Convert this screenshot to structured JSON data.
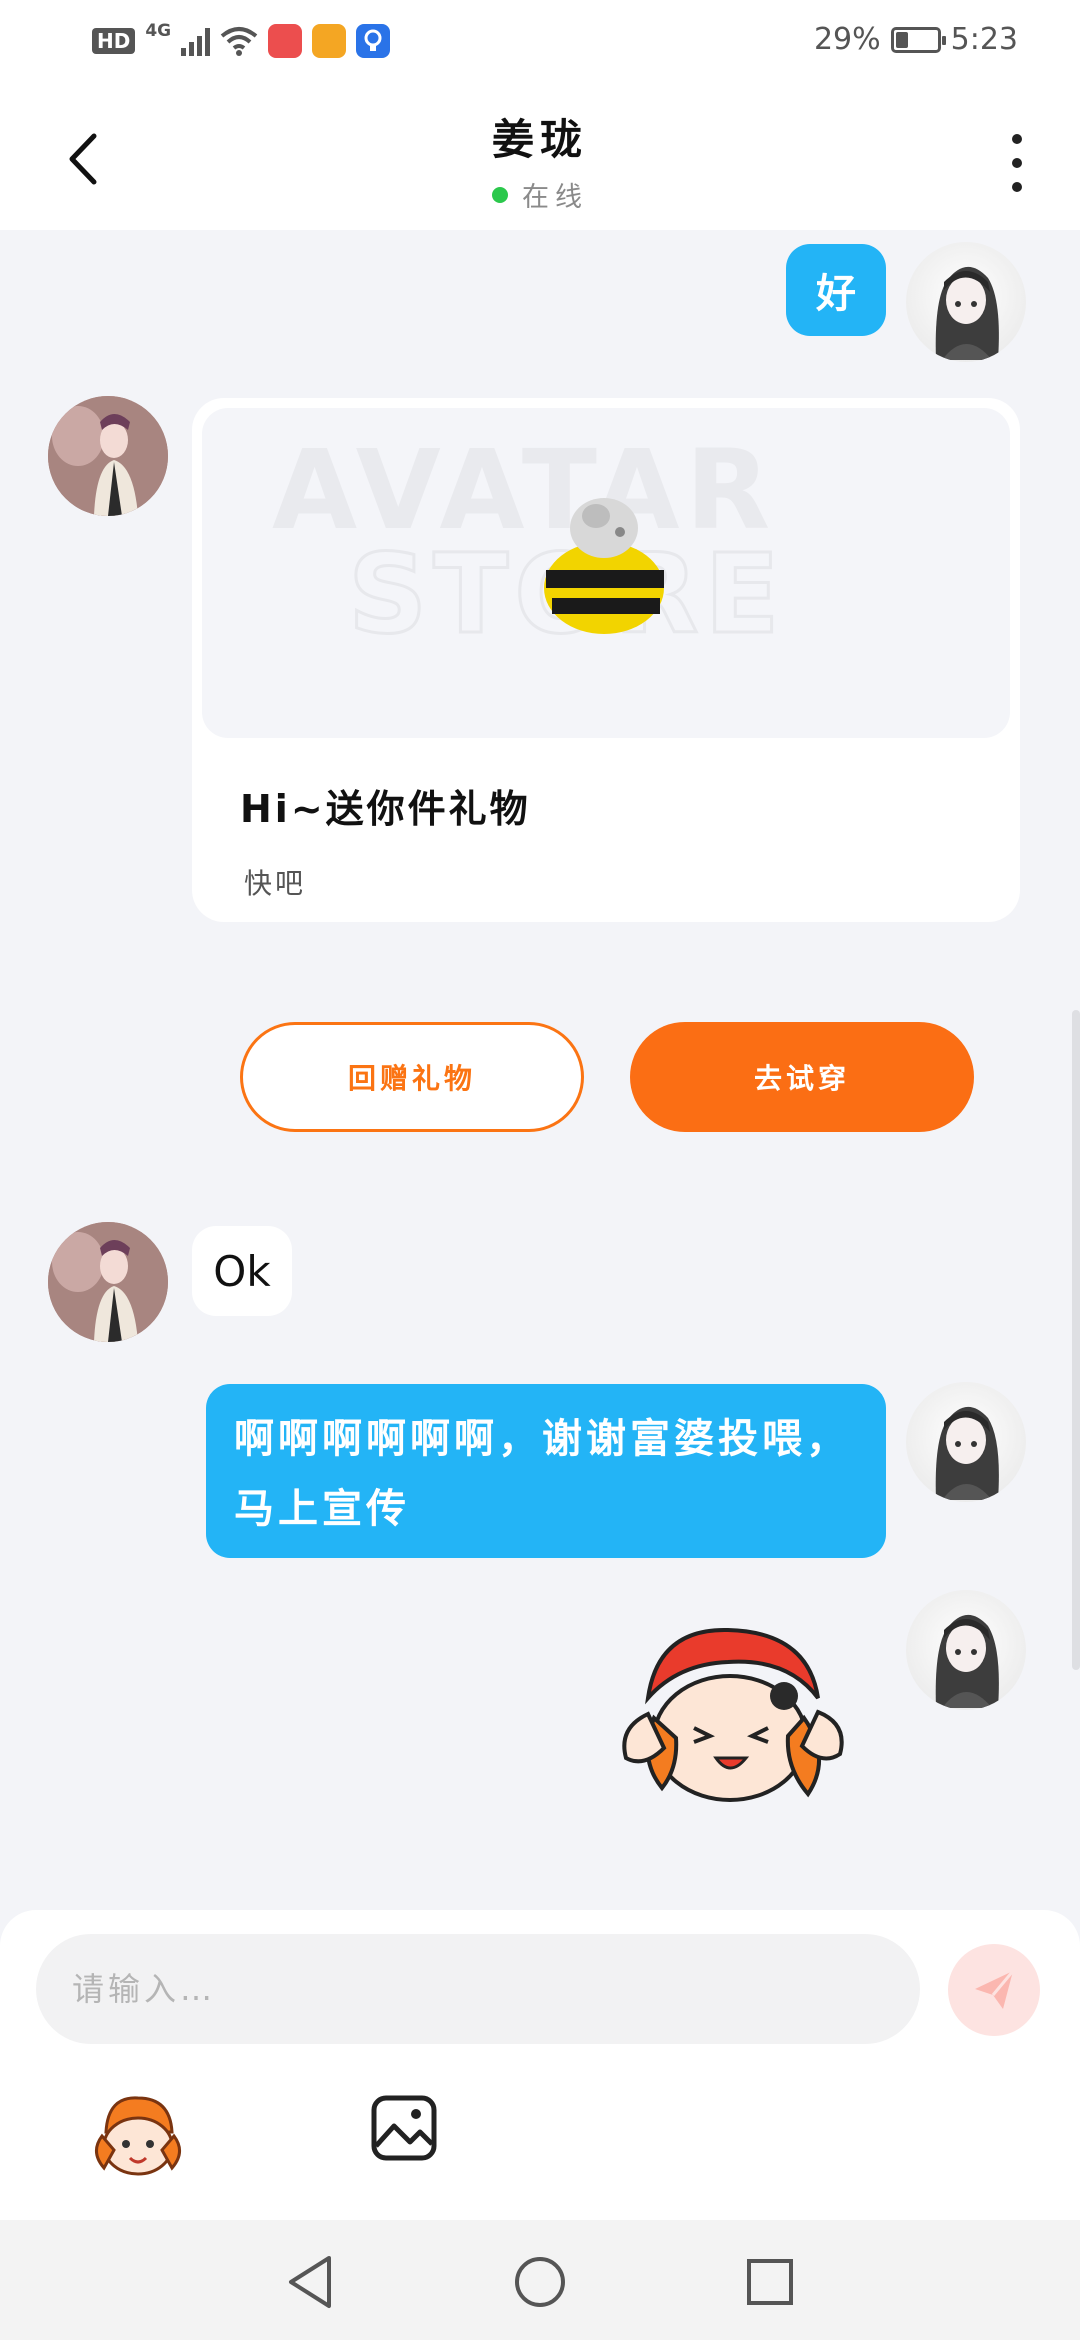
{
  "status_bar": {
    "network_label": "HD",
    "network_type": "4G",
    "battery": "29%",
    "time": "5:23",
    "battery_level": 0.29
  },
  "header": {
    "title": "姜珑",
    "status": "在线"
  },
  "messages": {
    "m1": "好",
    "gift": {
      "title": "Hi~送你件礼物",
      "subtitle": "快吧",
      "return_button": "回赠礼物",
      "try_button": "去试穿"
    },
    "m3": "Ok",
    "m4": "啊啊啊啊啊啊，谢谢富婆投喂，马上宣传"
  },
  "composer": {
    "placeholder": "请输入…"
  },
  "colors": {
    "accent_blue": "#23b4f6",
    "accent_orange": "#fb6e14",
    "online_green": "#2bc84c"
  },
  "icons": {
    "back": "chevron-left-icon",
    "more": "more-vertical-icon",
    "send": "paper-plane-icon",
    "emoji": "sticker-face-icon",
    "image": "image-icon"
  }
}
